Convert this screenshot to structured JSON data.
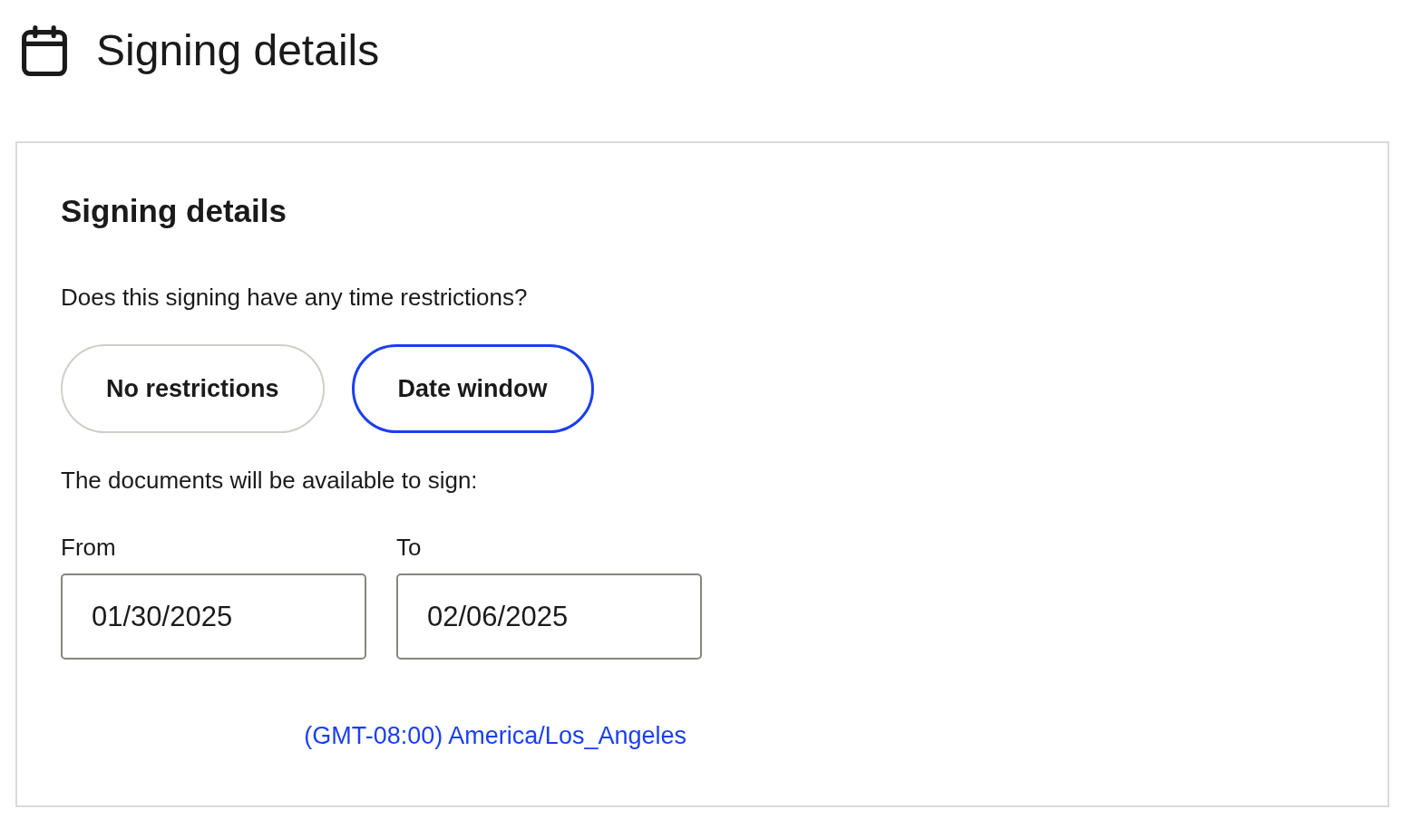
{
  "header": {
    "title": "Signing details"
  },
  "card": {
    "title": "Signing details",
    "question": "Does this signing have any time restrictions?",
    "options": [
      {
        "label": "No restrictions",
        "selected": false
      },
      {
        "label": "Date window",
        "selected": true
      }
    ],
    "availability_label": "The documents will be available to sign:",
    "date_fields": [
      {
        "label": "From",
        "value": "01/30/2025"
      },
      {
        "label": "To",
        "value": "02/06/2025"
      }
    ],
    "timezone_link": "(GMT-08:00) America/Los_Angeles"
  }
}
